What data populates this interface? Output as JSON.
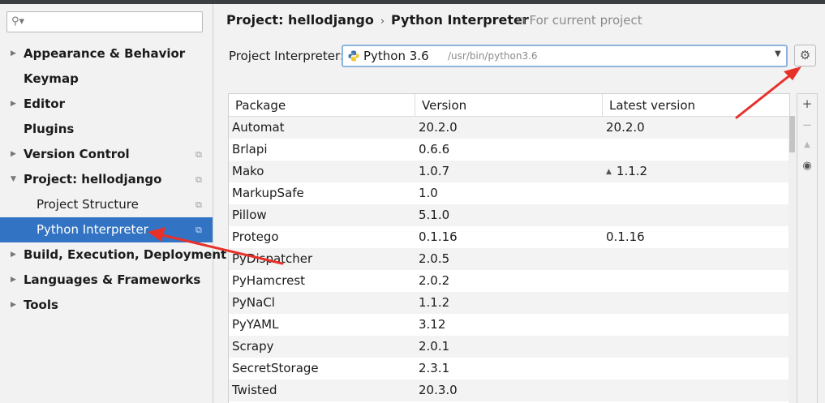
{
  "search": {
    "placeholder": ""
  },
  "sidebar": {
    "items": [
      {
        "label": "Appearance & Behavior",
        "arrow": "▶",
        "copy": ""
      },
      {
        "label": "Keymap",
        "arrow": "",
        "copy": ""
      },
      {
        "label": "Editor",
        "arrow": "▶",
        "copy": ""
      },
      {
        "label": "Plugins",
        "arrow": "",
        "copy": ""
      },
      {
        "label": "Version Control",
        "arrow": "▶",
        "copy": "⧉"
      },
      {
        "label": "Project: hellodjango",
        "arrow": "▼",
        "copy": "⧉"
      },
      {
        "label": "Project Structure",
        "arrow": "",
        "copy": "⧉"
      },
      {
        "label": "Python Interpreter",
        "arrow": "",
        "copy": "⧉"
      },
      {
        "label": "Build, Execution, Deployment",
        "arrow": "▶",
        "copy": ""
      },
      {
        "label": "Languages & Frameworks",
        "arrow": "▶",
        "copy": ""
      },
      {
        "label": "Tools",
        "arrow": "▶",
        "copy": ""
      }
    ]
  },
  "breadcrumb": {
    "project": "Project: hellodjango",
    "separator": "›",
    "page": "Python Interpreter"
  },
  "scope": {
    "icon": "⧉",
    "label": "For current project"
  },
  "interpreter": {
    "label": "Project Interpreter:",
    "name": "Python 3.6",
    "path": "/usr/bin/python3.6",
    "dropdown_icon": "▼"
  },
  "gear_icon": "⚙",
  "table": {
    "headers": [
      "Package",
      "Version",
      "Latest version"
    ],
    "rows": [
      {
        "package": "Automat",
        "version": "20.2.0",
        "latest": "20.2.0",
        "upgrade": ""
      },
      {
        "package": "Brlapi",
        "version": "0.6.6",
        "latest": "",
        "upgrade": ""
      },
      {
        "package": "Mako",
        "version": "1.0.7",
        "latest": "1.1.2",
        "upgrade": "▲"
      },
      {
        "package": "MarkupSafe",
        "version": "1.0",
        "latest": "",
        "upgrade": ""
      },
      {
        "package": "Pillow",
        "version": "5.1.0",
        "latest": "",
        "upgrade": ""
      },
      {
        "package": "Protego",
        "version": "0.1.16",
        "latest": "0.1.16",
        "upgrade": ""
      },
      {
        "package": "PyDispatcher",
        "version": "2.0.5",
        "latest": "",
        "upgrade": ""
      },
      {
        "package": "PyHamcrest",
        "version": "2.0.2",
        "latest": "",
        "upgrade": ""
      },
      {
        "package": "PyNaCl",
        "version": "1.1.2",
        "latest": "",
        "upgrade": ""
      },
      {
        "package": "PyYAML",
        "version": "3.12",
        "latest": "",
        "upgrade": ""
      },
      {
        "package": "Scrapy",
        "version": "2.0.1",
        "latest": "",
        "upgrade": ""
      },
      {
        "package": "SecretStorage",
        "version": "2.3.1",
        "latest": "",
        "upgrade": ""
      },
      {
        "package": "Twisted",
        "version": "20.3.0",
        "latest": "",
        "upgrade": ""
      }
    ]
  },
  "tools": {
    "add": "+",
    "remove": "−",
    "upgrade": "▲",
    "show_early": "◉"
  },
  "colors": {
    "selection": "#3273c4",
    "annotation": "#e8302a",
    "focus_border": "#8fb4e0"
  }
}
